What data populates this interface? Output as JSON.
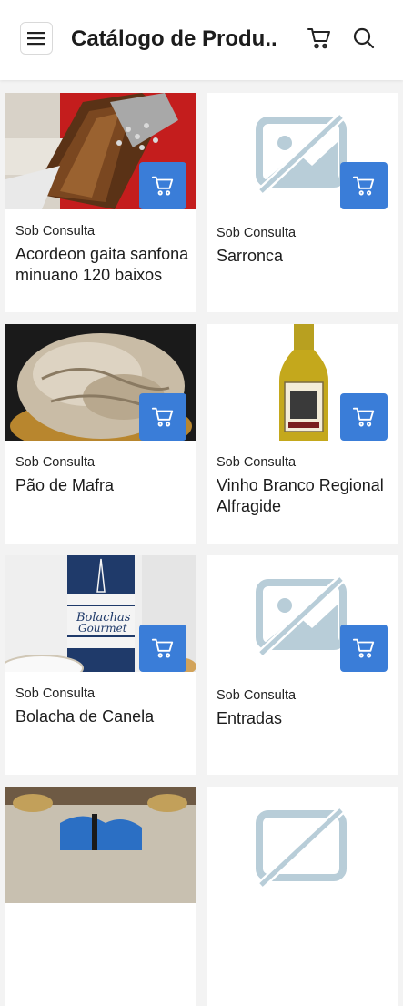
{
  "header": {
    "title": "Catálogo de Produ..",
    "menu_icon": "hamburger-menu-icon",
    "cart_icon": "shopping-cart-icon",
    "search_icon": "search-icon"
  },
  "colors": {
    "accent": "#3a7dd8",
    "placeholder": "#b8cdd8",
    "background": "#f3f3f3"
  },
  "products": [
    {
      "price": "Sob Consulta",
      "name": "Acordeon gaita sanfona minuano 120 baixos",
      "image": "accordion-photo"
    },
    {
      "price": "Sob Consulta",
      "name": "Sarronca",
      "image": "image-placeholder"
    },
    {
      "price": "Sob Consulta",
      "name": "Pão de Mafra",
      "image": "bread-photo"
    },
    {
      "price": "Sob Consulta",
      "name": "Vinho Branco Regional Alfragide",
      "image": "wine-bottle-photo"
    },
    {
      "price": "Sob Consulta",
      "name": "Bolacha de Canela",
      "image": "biscuit-tin-photo"
    },
    {
      "price": "Sob Consulta",
      "name": "Entradas",
      "image": "image-placeholder"
    },
    {
      "price": "",
      "name": "",
      "image": "guitar-photo"
    },
    {
      "price": "",
      "name": "",
      "image": "image-placeholder"
    }
  ],
  "tin_labels": {
    "line1": "Bolachas",
    "line2": "Gourmet"
  }
}
